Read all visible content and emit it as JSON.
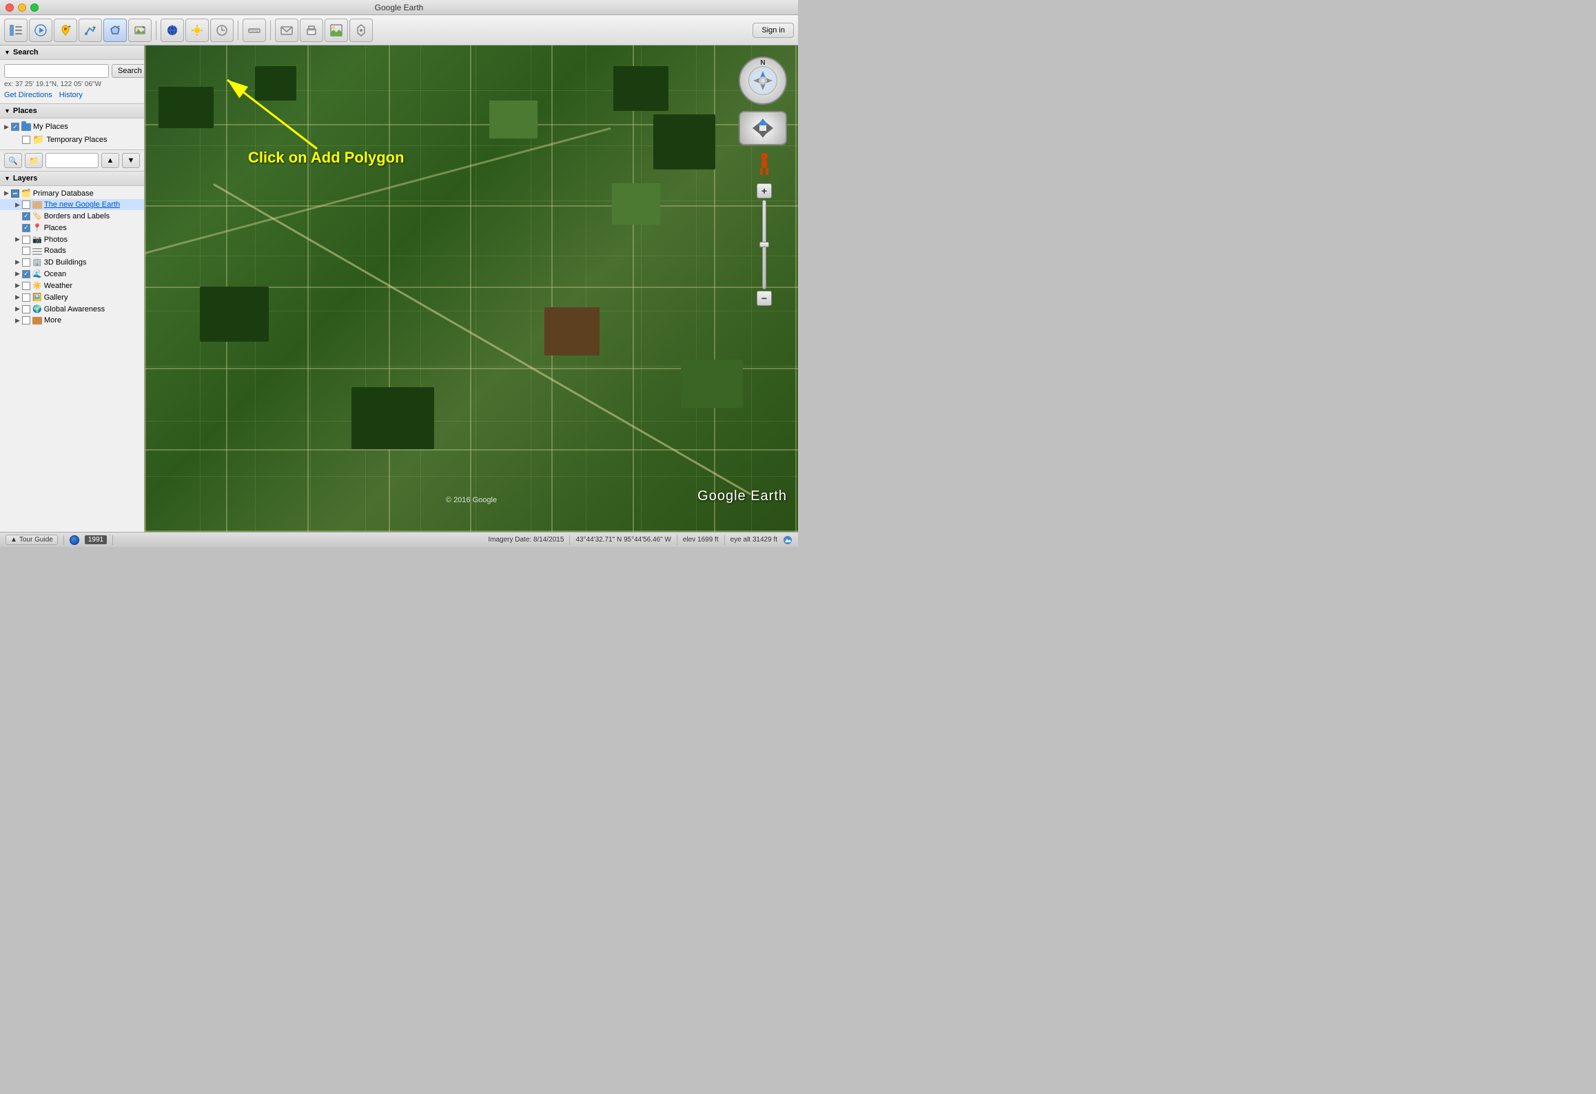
{
  "window": {
    "title": "Google Earth"
  },
  "toolbar": {
    "signin_label": "Sign in"
  },
  "search": {
    "section_label": "Search",
    "placeholder": "",
    "search_btn": "Search",
    "hint": "ex: 37 25' 19.1\"N, 122 05' 06\"W",
    "get_directions": "Get Directions",
    "history": "History"
  },
  "places": {
    "section_label": "Places",
    "items": [
      {
        "label": "My Places",
        "type": "folder-checked",
        "expanded": true
      },
      {
        "label": "Temporary Places",
        "type": "folder",
        "expanded": false
      }
    ]
  },
  "layers": {
    "section_label": "Layers",
    "items": [
      {
        "label": "Primary Database",
        "type": "folder-multi",
        "indent": 0
      },
      {
        "label": "The new Google Earth",
        "type": "folder",
        "indent": 1,
        "link": true
      },
      {
        "label": "Borders and Labels",
        "type": "checked-icon",
        "indent": 1
      },
      {
        "label": "Places",
        "type": "checked-square",
        "indent": 1
      },
      {
        "label": "Photos",
        "type": "unchecked",
        "indent": 1
      },
      {
        "label": "Roads",
        "type": "unchecked-road",
        "indent": 1
      },
      {
        "label": "3D Buildings",
        "type": "unchecked-3d",
        "indent": 1
      },
      {
        "label": "Ocean",
        "type": "checked-ocean",
        "indent": 1
      },
      {
        "label": "Weather",
        "type": "unchecked-weather",
        "indent": 1
      },
      {
        "label": "Gallery",
        "type": "unchecked-gallery",
        "indent": 1
      },
      {
        "label": "Global Awareness",
        "type": "unchecked-globe",
        "indent": 1
      },
      {
        "label": "More",
        "type": "unchecked-folder",
        "indent": 1
      }
    ]
  },
  "map": {
    "annotation_text": "Click on Add Polygon",
    "copyright": "© 2016 Google",
    "watermark": "Google Earth"
  },
  "statusbar": {
    "tour_guide": "Tour Guide",
    "year": "1991",
    "imagery_date": "Imagery Date: 8/14/2015",
    "coordinates": "43°44'32.71\" N   95°44'56.46\" W",
    "elevation": "elev  1699 ft",
    "eye_alt": "eye alt  31429 ft"
  }
}
